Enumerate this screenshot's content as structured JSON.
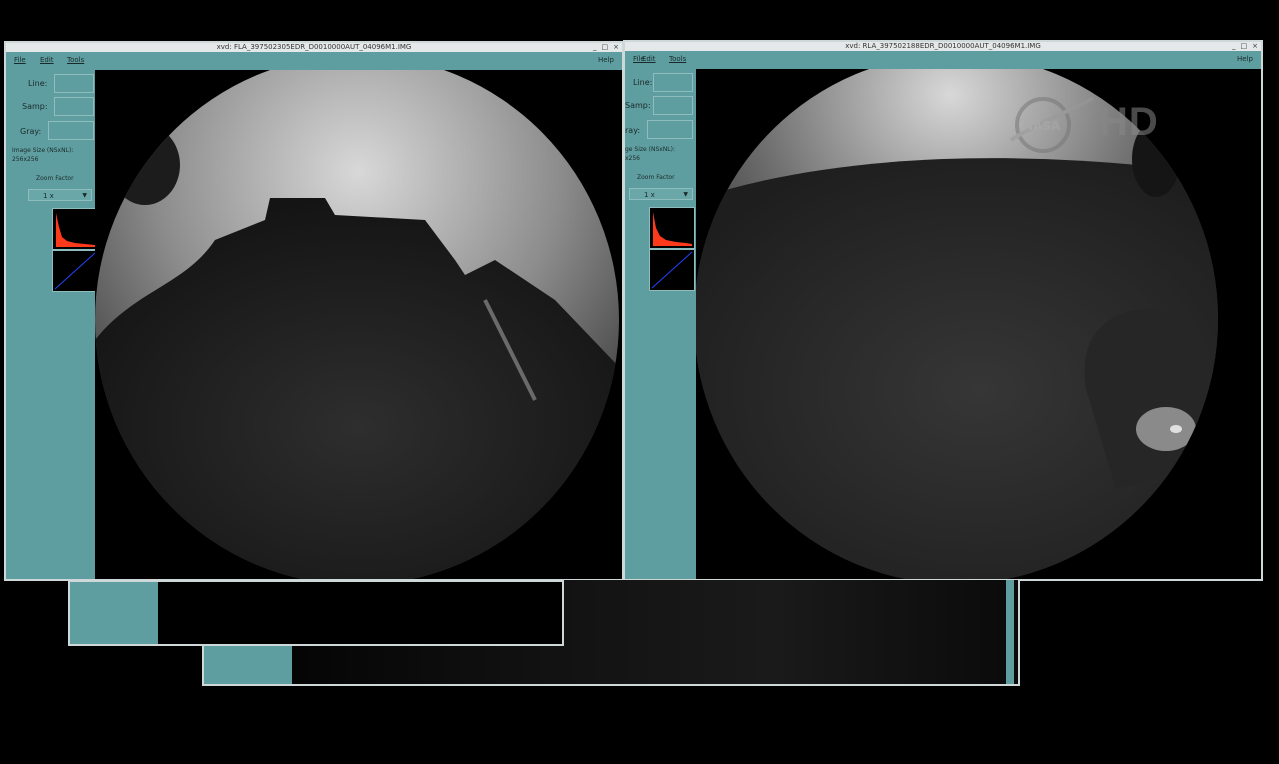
{
  "left_window": {
    "title": "xvd: FLA_397502305EDR_D0010000AUT_04096M1.IMG",
    "window_buttons": [
      "_",
      "□",
      "×"
    ],
    "menu": {
      "file": "File",
      "edit": "Edit",
      "tools": "Tools",
      "help": "Help"
    },
    "labels": {
      "line": "Line:",
      "samp": "Samp:",
      "gray": "Gray:"
    },
    "image_size_label": "Image Size (NSxNL):",
    "image_size_value": "256x256",
    "zoom_label": "Zoom Factor",
    "zoom_value": "1 x"
  },
  "right_window": {
    "title": "xvd: RLA_397502188EDR_D0010000AUT_04096M1.IMG",
    "window_buttons": [
      "_",
      "□",
      "×"
    ],
    "menu": {
      "file": "File",
      "edit": "Edit",
      "tools": "Tools",
      "help": "Help"
    },
    "labels": {
      "line": "Line:",
      "samp": "Samp:",
      "gray": "ray:"
    },
    "image_size_label": "ge Size (NSxNL):",
    "image_size_value": "x256",
    "zoom_label": "Zoom Factor",
    "zoom_value": "1 x"
  },
  "overlay": {
    "brand_icon": "nasa-meatball-icon",
    "hd_label": "HD"
  },
  "colors": {
    "panel": "#5f9ea0",
    "histogram": "#ff3a1a",
    "background": "#000000"
  }
}
